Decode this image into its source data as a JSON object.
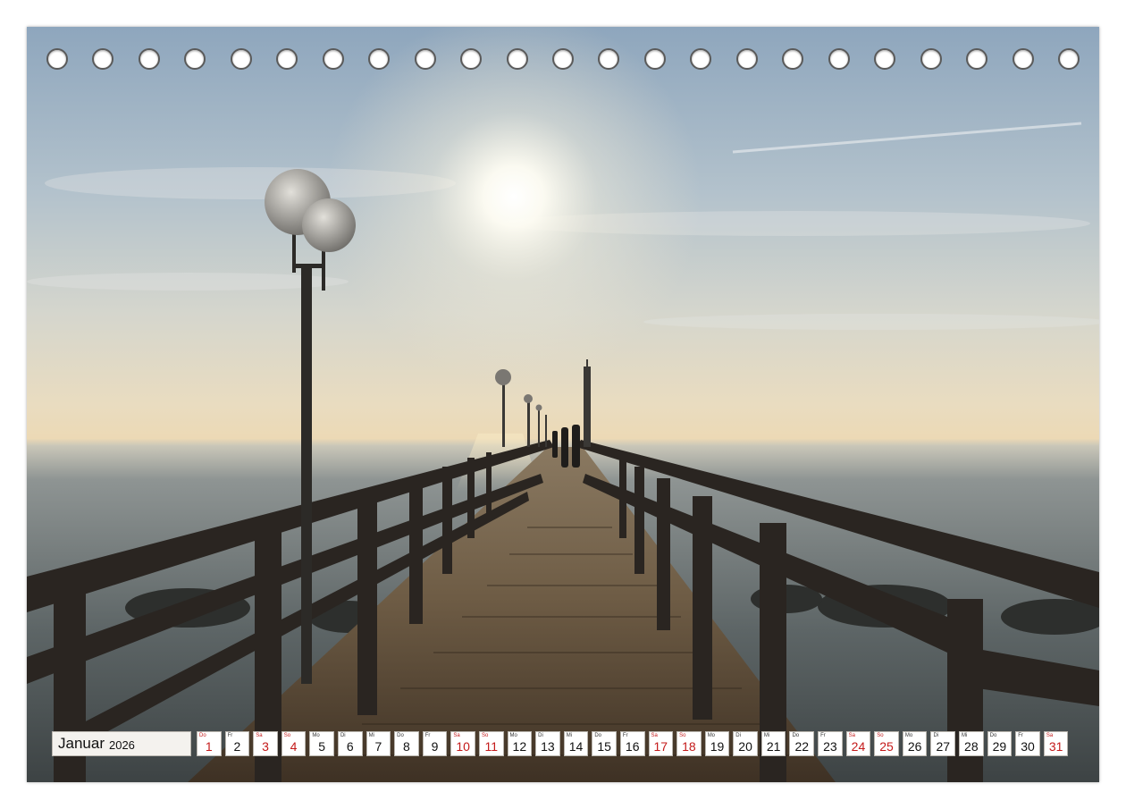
{
  "calendar": {
    "month": "Januar",
    "year": "2026",
    "weekend_color": "#c41a1a",
    "days": [
      {
        "wd": "Do",
        "d": "1",
        "we": true
      },
      {
        "wd": "Fr",
        "d": "2",
        "we": false
      },
      {
        "wd": "Sa",
        "d": "3",
        "we": true
      },
      {
        "wd": "So",
        "d": "4",
        "we": true
      },
      {
        "wd": "Mo",
        "d": "5",
        "we": false
      },
      {
        "wd": "Di",
        "d": "6",
        "we": false
      },
      {
        "wd": "Mi",
        "d": "7",
        "we": false
      },
      {
        "wd": "Do",
        "d": "8",
        "we": false
      },
      {
        "wd": "Fr",
        "d": "9",
        "we": false
      },
      {
        "wd": "Sa",
        "d": "10",
        "we": true
      },
      {
        "wd": "So",
        "d": "11",
        "we": true
      },
      {
        "wd": "Mo",
        "d": "12",
        "we": false
      },
      {
        "wd": "Di",
        "d": "13",
        "we": false
      },
      {
        "wd": "Mi",
        "d": "14",
        "we": false
      },
      {
        "wd": "Do",
        "d": "15",
        "we": false
      },
      {
        "wd": "Fr",
        "d": "16",
        "we": false
      },
      {
        "wd": "Sa",
        "d": "17",
        "we": true
      },
      {
        "wd": "So",
        "d": "18",
        "we": true
      },
      {
        "wd": "Mo",
        "d": "19",
        "we": false
      },
      {
        "wd": "Di",
        "d": "20",
        "we": false
      },
      {
        "wd": "Mi",
        "d": "21",
        "we": false
      },
      {
        "wd": "Do",
        "d": "22",
        "we": false
      },
      {
        "wd": "Fr",
        "d": "23",
        "we": false
      },
      {
        "wd": "Sa",
        "d": "24",
        "we": true
      },
      {
        "wd": "So",
        "d": "25",
        "we": true
      },
      {
        "wd": "Mo",
        "d": "26",
        "we": false
      },
      {
        "wd": "Di",
        "d": "27",
        "we": false
      },
      {
        "wd": "Mi",
        "d": "28",
        "we": false
      },
      {
        "wd": "Do",
        "d": "29",
        "we": false
      },
      {
        "wd": "Fr",
        "d": "30",
        "we": false
      },
      {
        "wd": "Sa",
        "d": "31",
        "we": true
      }
    ]
  },
  "binding": {
    "hole_count": 23
  },
  "photo": {
    "subject": "wooden-pier-at-sunset"
  }
}
